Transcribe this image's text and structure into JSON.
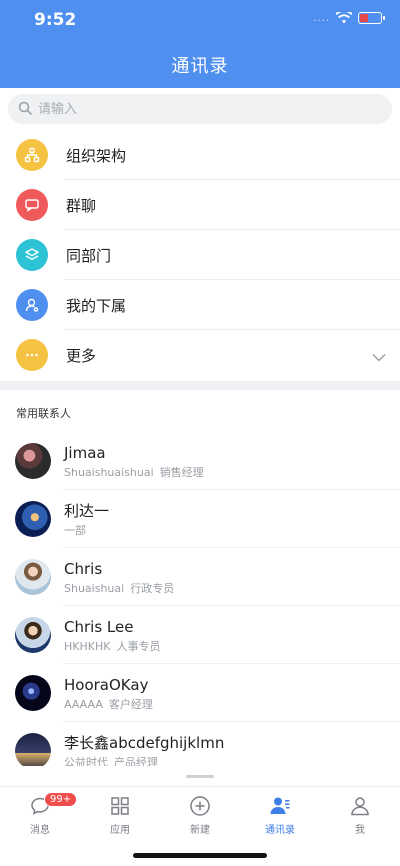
{
  "status": {
    "time": "9:52",
    "signal": "....",
    "battery_color": "#e5484d"
  },
  "header": {
    "title": "通讯录",
    "bg_color": "#4f8ff0"
  },
  "search": {
    "placeholder": "请输入",
    "value": ""
  },
  "menu": [
    {
      "label": "组织架构",
      "icon": "org-chart-icon",
      "color": "#f5c242"
    },
    {
      "label": "群聊",
      "icon": "chat-group-icon",
      "color": "#ef5a5a"
    },
    {
      "label": "同部门",
      "icon": "layers-icon",
      "color": "#2cc3d6"
    },
    {
      "label": "我的下属",
      "icon": "user-icon",
      "color": "#4f8ff0"
    },
    {
      "label": "更多",
      "icon": "more-icon",
      "color": "#f5c242",
      "has_chevron": true
    }
  ],
  "section": {
    "title": "常用联系人"
  },
  "contacts": [
    {
      "name": "Jimaa",
      "account": "Shuaishuaishuai",
      "role": "销售经理"
    },
    {
      "name": "利达一",
      "account": "一部",
      "role": ""
    },
    {
      "name": "Chris",
      "account": "Shuaishuai",
      "role": "行政专员"
    },
    {
      "name": "Chris Lee",
      "account": "HKHKHK",
      "role": "人事专员"
    },
    {
      "name": "HooraOKay",
      "account": "AAAAA",
      "role": "客户经理"
    },
    {
      "name": "李长鑫abcdefghijklmn",
      "account": "公益时代",
      "role": "产品经理"
    }
  ],
  "tabbar": {
    "items": [
      {
        "label": "消息",
        "icon": "message-icon",
        "badge": "99+",
        "active": false
      },
      {
        "label": "应用",
        "icon": "apps-grid-icon",
        "active": false
      },
      {
        "label": "新建",
        "icon": "add-circle-icon",
        "active": false
      },
      {
        "label": "通讯录",
        "icon": "contacts-icon",
        "active": true
      },
      {
        "label": "我",
        "icon": "profile-icon",
        "active": false
      }
    ],
    "active_color": "#3f7fe8"
  }
}
